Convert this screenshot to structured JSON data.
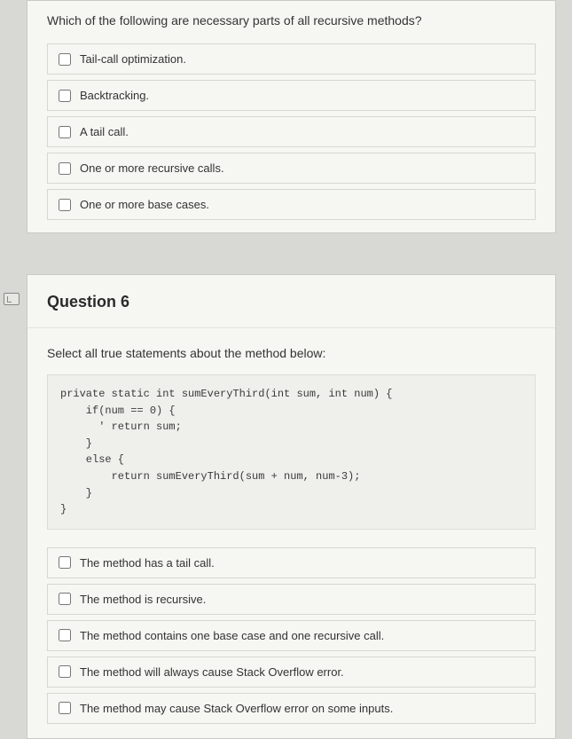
{
  "q5": {
    "prompt": "Which of the following are necessary parts of all recursive methods?",
    "options": [
      "Tail-call optimization.",
      "Backtracking.",
      "A tail call.",
      "One or more recursive calls.",
      "One or more base cases."
    ]
  },
  "q6": {
    "title": "Question 6",
    "prompt": "Select all true statements about the method below:",
    "code": "private static int sumEveryThird(int sum, int num) {\n    if(num == 0) {\n      ' return sum;\n    }\n    else {\n        return sumEveryThird(sum + num, num-3);\n    }\n}",
    "options": [
      "The method has a tail call.",
      "The method is recursive.",
      "The method contains one base case and one recursive call.",
      "The method will always cause Stack Overflow error.",
      "The method may cause Stack Overflow error on some inputs."
    ]
  }
}
